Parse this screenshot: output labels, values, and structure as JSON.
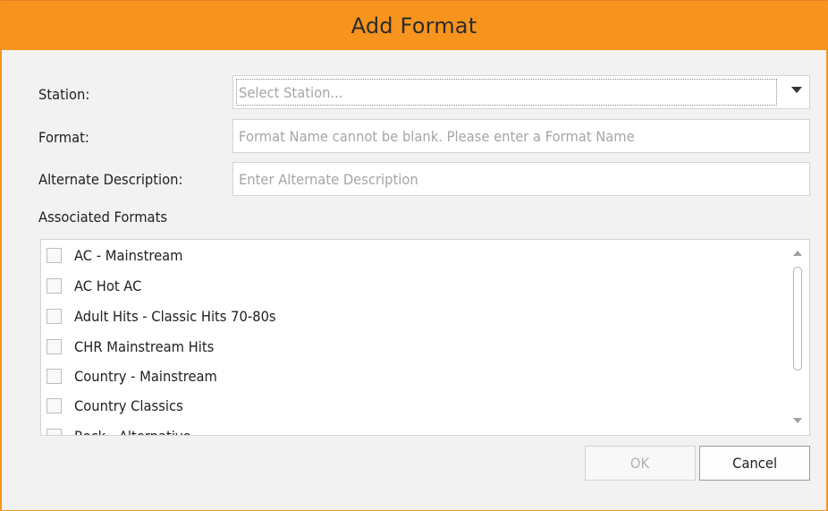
{
  "dialog": {
    "title": "Add Format",
    "accent_color": "#f7941d"
  },
  "form": {
    "station": {
      "label": "Station:",
      "placeholder": "Select Station..."
    },
    "format": {
      "label": "Format:",
      "placeholder": "Format Name cannot be blank.  Please enter a Format Name"
    },
    "alternate_description": {
      "label": "Alternate Description:",
      "placeholder": "Enter Alternate Description"
    }
  },
  "associated_formats": {
    "label": "Associated Formats",
    "items": [
      {
        "label": "AC - Mainstream",
        "checked": false
      },
      {
        "label": "AC Hot AC",
        "checked": false
      },
      {
        "label": "Adult Hits - Classic Hits 70-80s",
        "checked": false
      },
      {
        "label": "CHR Mainstream Hits",
        "checked": false
      },
      {
        "label": "Country - Mainstream",
        "checked": false
      },
      {
        "label": "Country Classics",
        "checked": false
      },
      {
        "label": "Rock - Alternative",
        "checked": false
      }
    ]
  },
  "buttons": {
    "ok": {
      "label": "OK",
      "enabled": false
    },
    "cancel": {
      "label": "Cancel",
      "enabled": true
    }
  }
}
